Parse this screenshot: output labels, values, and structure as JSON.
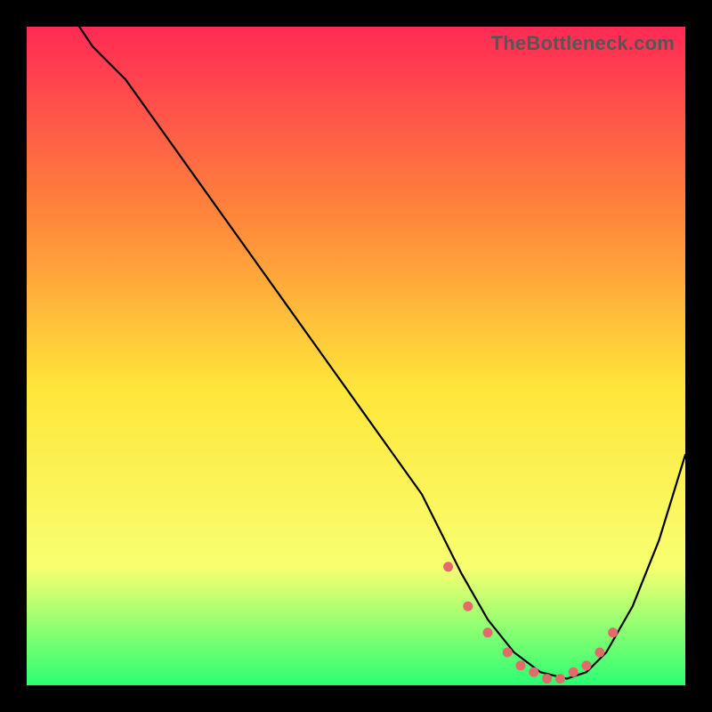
{
  "watermark": "TheBottleneck.com",
  "chart_data": {
    "type": "line",
    "title": "",
    "xlabel": "",
    "ylabel": "",
    "xlim": [
      0,
      100
    ],
    "ylim": [
      0,
      100
    ],
    "background_gradient": {
      "top": "#ff2a55",
      "mid_upper": "#ff8a3a",
      "mid": "#ffe63a",
      "mid_lower": "#f8ff70",
      "bottom": "#2aff73"
    },
    "series": [
      {
        "name": "bottleneck-curve",
        "color": "#000000",
        "x": [
          8,
          10,
          15,
          20,
          25,
          30,
          35,
          40,
          45,
          50,
          55,
          60,
          63,
          66,
          70,
          74,
          78,
          82,
          85,
          88,
          92,
          96,
          100
        ],
        "values": [
          100,
          97,
          92,
          85,
          78,
          71,
          64,
          57,
          50,
          43,
          36,
          29,
          23,
          17,
          10,
          5,
          2,
          1,
          2,
          5,
          12,
          22,
          35
        ]
      },
      {
        "name": "highlight-dots",
        "color": "#e36a6a",
        "x": [
          64,
          67,
          70,
          73,
          75,
          77,
          79,
          81,
          83,
          85,
          87,
          89
        ],
        "values": [
          18,
          12,
          8,
          5,
          3,
          2,
          1,
          1,
          2,
          3,
          5,
          8
        ]
      }
    ]
  }
}
